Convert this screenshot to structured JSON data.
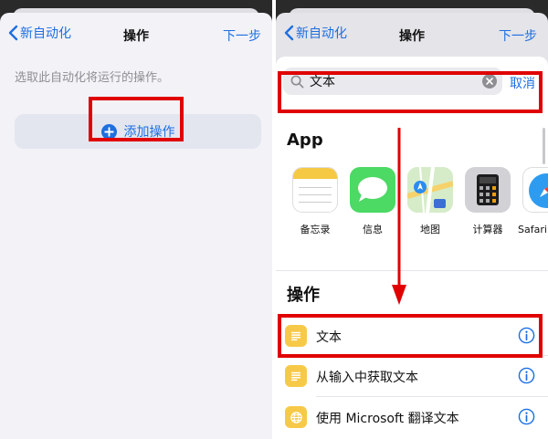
{
  "left": {
    "nav": {
      "back_label": "新自动化",
      "title": "操作",
      "next_label": "下一步"
    },
    "hint": "选取此自动化将运行的操作。",
    "add_action_label": "添加操作"
  },
  "right": {
    "nav": {
      "back_label": "新自动化",
      "title": "操作",
      "next_label": "下一步"
    },
    "search": {
      "value": "文本",
      "cancel_label": "取消"
    },
    "apps_header": "App",
    "apps": [
      {
        "label": "备忘录",
        "icon": "notes-icon"
      },
      {
        "label": "信息",
        "icon": "messages-icon"
      },
      {
        "label": "地图",
        "icon": "maps-icon"
      },
      {
        "label": "计算器",
        "icon": "calculator-icon"
      },
      {
        "label": "Safari 浏览器",
        "icon": "safari-icon"
      }
    ],
    "actions_header": "操作",
    "actions": [
      {
        "label": "文本",
        "icon": "text-icon"
      },
      {
        "label": "从输入中获取文本",
        "icon": "text-icon"
      },
      {
        "label": "使用 Microsoft 翻译文本",
        "icon": "globe-icon"
      }
    ]
  },
  "colors": {
    "accent": "#1e6fe0",
    "highlight": "#e00000",
    "action_icon": "#f7c948"
  }
}
